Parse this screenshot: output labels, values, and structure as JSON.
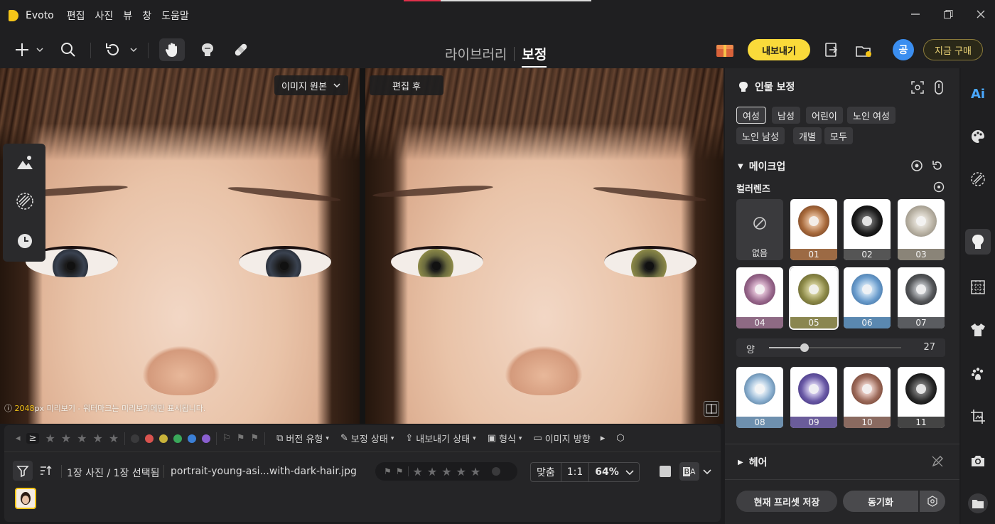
{
  "app": {
    "name": "Evoto"
  },
  "menu": [
    "편집",
    "사진",
    "뷰",
    "창",
    "도움말"
  ],
  "view_tabs": {
    "library": "라이브러리",
    "retouch": "보정"
  },
  "toolbar": {
    "export_label": "내보내기",
    "user_initial": "공",
    "buy_label": "지금 구매"
  },
  "canvas": {
    "original_label": "이미지 원본",
    "after_label": "편집 후",
    "watermark_res": "2048",
    "watermark_unit": "px",
    "watermark_text": "미리보기 - 워터마크는 미리보기에만 표시됩니다."
  },
  "meta_bar": {
    "version_type": "버전 유형",
    "edit_status": "보정 상태",
    "export_status": "내보내기 상태",
    "format": "형식",
    "orientation": "이미지 방향",
    "color_dots": [
      "#3a3a3c",
      "#d9534f",
      "#c9b33a",
      "#3aa85a",
      "#3b7fd6",
      "#8a5fd0"
    ]
  },
  "info_bar": {
    "count": "1장 사진 / 1장 선택됨",
    "filename": "portrait-young-asi...with-dark-hair.jpg",
    "fit_label": "맞춤",
    "ratio_label": "1:1",
    "zoom": "64%"
  },
  "panel": {
    "title": "인물 보정",
    "chips": [
      "여성",
      "남성",
      "어린이",
      "노인 여성",
      "노인 남성",
      "개별",
      "모두"
    ],
    "active_chip": "여성",
    "makeup_title": "메이크업",
    "color_lens_title": "컬러렌즈",
    "none_label": "없음",
    "lenses": [
      {
        "label": "01",
        "color": "#a86a3c",
        "bar": "#9c6a44"
      },
      {
        "label": "02",
        "color": "#1e1e1e",
        "bar": "#555555"
      },
      {
        "label": "03",
        "color": "#b9b2a4",
        "bar": "#8a8478"
      },
      {
        "label": "04",
        "color": "#9a6a8e",
        "bar": "#8e6a84"
      },
      {
        "label": "05",
        "color": "#8d8a48",
        "bar": "#8a8650"
      },
      {
        "label": "06",
        "color": "#6a9ccc",
        "bar": "#5a88b0"
      },
      {
        "label": "07",
        "color": "#55575a",
        "bar": "#5a5c60"
      },
      {
        "label": "08",
        "color": "#8cb0d0",
        "bar": "#6e90ae"
      },
      {
        "label": "09",
        "color": "#6a5aa6",
        "bar": "#6a5c9a"
      },
      {
        "label": "10",
        "color": "#9c6a5a",
        "bar": "#8a6a60"
      },
      {
        "label": "11",
        "color": "#2a2a2a",
        "bar": "#444444"
      }
    ],
    "selected_lens": "05",
    "amount_label": "양",
    "amount_value": "27",
    "amount_fraction": 0.27,
    "hair_title": "헤어",
    "save_preset": "현재 프리셋 저장",
    "sync": "동기화"
  },
  "rail": {
    "ai_label": "Ai"
  }
}
